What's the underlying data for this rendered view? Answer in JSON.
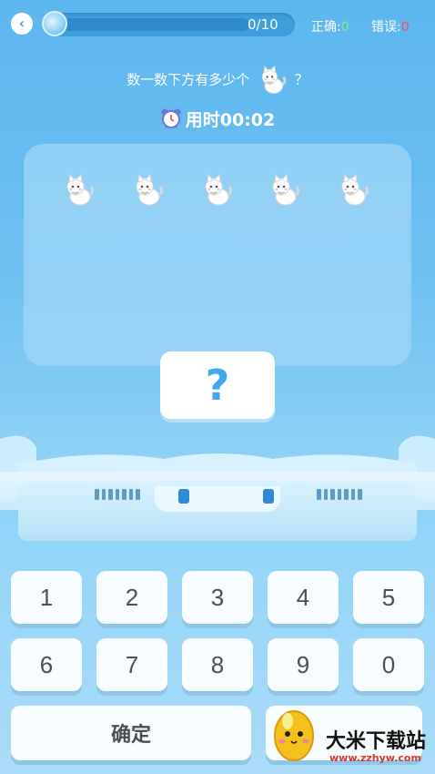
{
  "header": {
    "back_icon": "chevron-left-icon",
    "progress_text": "0/10",
    "progress_fraction": 0,
    "correct_label": "正确:",
    "correct_count": "0",
    "wrong_label": "错误:",
    "wrong_count": "0"
  },
  "question": {
    "text_before": "数一数下方有多少个",
    "icon": "cat-icon",
    "text_after": "？"
  },
  "timer": {
    "icon": "alarm-clock-icon",
    "label": "用时",
    "value": "00:02"
  },
  "cats": {
    "count": 5,
    "icon": "white-cat"
  },
  "answer": {
    "value": "?"
  },
  "keypad": {
    "keys": [
      "1",
      "2",
      "3",
      "4",
      "5",
      "6",
      "7",
      "8",
      "9",
      "0"
    ],
    "confirm_label": "确定"
  },
  "watermark": {
    "brand": "大米下载站",
    "url": "www.zzhyw.com"
  },
  "colors": {
    "background_top": "#5cb6ee",
    "correct_green": "#7cf57c",
    "wrong_red": "#ff4d4d",
    "question_mark_blue": "#3fa9ee"
  }
}
